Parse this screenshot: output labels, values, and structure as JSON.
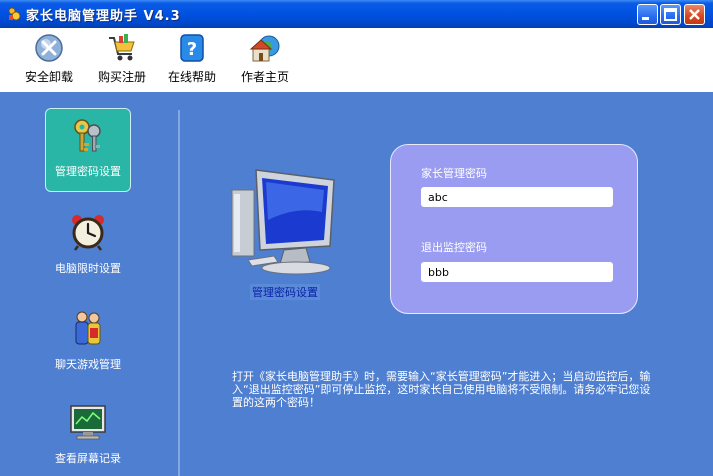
{
  "window": {
    "title": "家长电脑管理助手  V4.3"
  },
  "toolbar": {
    "items": [
      {
        "label": "安全卸载",
        "icon": "uninstall-icon"
      },
      {
        "label": "购买注册",
        "icon": "shopping-cart-icon"
      },
      {
        "label": "在线帮助",
        "icon": "help-icon"
      },
      {
        "label": "作者主页",
        "icon": "homepage-icon"
      }
    ]
  },
  "sidebar": {
    "items": [
      {
        "label": "管理密码设置",
        "icon": "keys-icon",
        "active": true
      },
      {
        "label": "电脑限时设置",
        "icon": "alarm-clock-icon",
        "active": false
      },
      {
        "label": "聊天游戏管理",
        "icon": "people-icon",
        "active": false
      },
      {
        "label": "查看屏幕记录",
        "icon": "screen-record-icon",
        "active": false
      }
    ]
  },
  "main": {
    "caption": "管理密码设置",
    "parent_password_label": "家长管理密码",
    "parent_password_value": "abc",
    "exit_password_label": "退出监控密码",
    "exit_password_value": "bbb",
    "help_text": "打开《家长电脑管理助手》时，需要输入“家长管理密码”才能进入；当启动监控后，输入“退出监控密码”即可停止监控，这时家长自己使用电脑将不受限制。请务必牢记您设置的这两个密码！"
  },
  "colors": {
    "title_bar": "#0052e0",
    "panel_background": "#4f7fd0",
    "active_nav": "#29b6a6",
    "password_panel": "#9a9cf2"
  }
}
